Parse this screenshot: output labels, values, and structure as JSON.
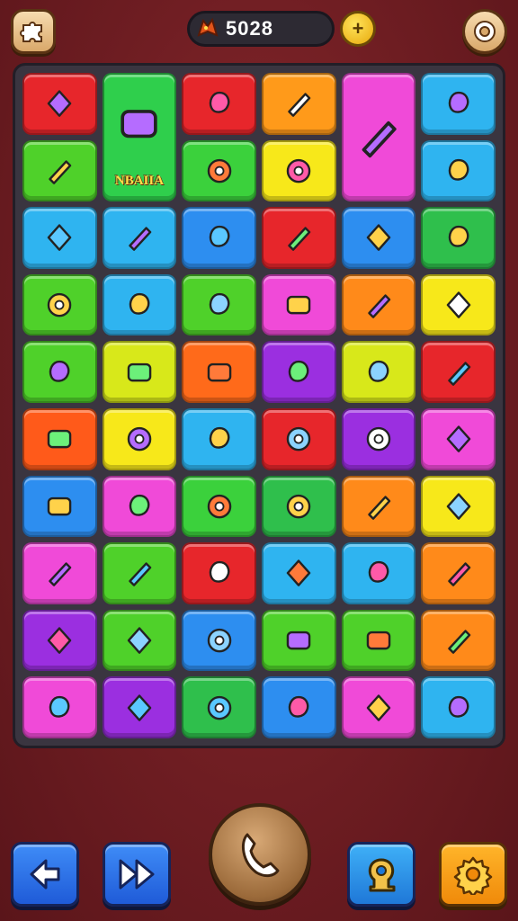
{
  "header": {
    "score": "5028",
    "coin_symbol": "+",
    "left_button_icon": "puzzle-icon",
    "right_button_icon": "settings-ring-icon",
    "score_icon": "dragon-head-icon"
  },
  "board": {
    "tiles": [
      {
        "color": "#e7262b",
        "icon": "toolbox-icon"
      },
      {
        "color": "#2fcf4c",
        "icon": "eagle-emblem-icon",
        "label": "NBAIIA"
      },
      {
        "color": "#e7262b",
        "icon": "flower-gear-icon"
      },
      {
        "color": "#ff9a1a",
        "icon": "ring-icon"
      },
      {
        "color": "#f04ad8",
        "icon": "dragon-icon"
      },
      {
        "color": "#2fb4f0",
        "icon": "flower-icon"
      },
      {
        "color": "#4fd12a",
        "icon": "battery-icon"
      },
      {
        "color": "#3bd13c",
        "icon": "car-icon"
      },
      {
        "color": "#f7e81a",
        "icon": "spiral-icon"
      },
      {
        "color": "#2fb4f0",
        "icon": "egg-icon"
      },
      {
        "color": "#2fb4f0",
        "icon": "gem-icon"
      },
      {
        "color": "#2fb4f0",
        "icon": "box-icon"
      },
      {
        "color": "#2d8ef0",
        "icon": "gear-icon"
      },
      {
        "color": "#e7262b",
        "icon": "briefcase-icon"
      },
      {
        "color": "#2d8ef0",
        "icon": "roast-icon"
      },
      {
        "color": "#2fbf4c",
        "icon": "stone-icon"
      },
      {
        "color": "#4fd12a",
        "icon": "pencil-icon"
      },
      {
        "color": "#2fb4f0",
        "icon": "blob-icon"
      },
      {
        "color": "#4fd12a",
        "icon": "crayon-icon"
      },
      {
        "color": "#f04ad8",
        "icon": "cactus-icon"
      },
      {
        "color": "#ff8a1a",
        "icon": "jar-icon"
      },
      {
        "color": "#f7e81a",
        "icon": "lips-icon"
      },
      {
        "color": "#4fd12a",
        "icon": "radio-icon"
      },
      {
        "color": "#d8e81a",
        "icon": "tv-icon"
      },
      {
        "color": "#ff6a1a",
        "icon": "cookie-icon"
      },
      {
        "color": "#9b2fe0",
        "icon": "bowl-icon"
      },
      {
        "color": "#d8e81a",
        "icon": "leaf-icon"
      },
      {
        "color": "#e7262b",
        "icon": "orb-icon"
      },
      {
        "color": "#ff5a1a",
        "icon": "marker-icon"
      },
      {
        "color": "#f7e81a",
        "icon": "drill-icon"
      },
      {
        "color": "#2fb4f0",
        "icon": "cloud-icon"
      },
      {
        "color": "#e7262b",
        "icon": "heart-icon"
      },
      {
        "color": "#9b2fe0",
        "icon": "wand-icon"
      },
      {
        "color": "#f04ad8",
        "icon": "hook-icon"
      },
      {
        "color": "#2d8ef0",
        "icon": "camera-icon"
      },
      {
        "color": "#f04ad8",
        "icon": "monitor-icon"
      },
      {
        "color": "#3bd13c",
        "icon": "sun-icon"
      },
      {
        "color": "#2fbf4c",
        "icon": "maple-icon"
      },
      {
        "color": "#ff8a1a",
        "icon": "crossed-tools-icon"
      },
      {
        "color": "#f7e81a",
        "icon": "dino-icon"
      },
      {
        "color": "#f04ad8",
        "icon": "cone-icon"
      },
      {
        "color": "#4fd12a",
        "icon": "rose-icon"
      },
      {
        "color": "#e7262b",
        "icon": "fish-icon"
      },
      {
        "color": "#2fb4f0",
        "icon": "purple-egg-icon"
      },
      {
        "color": "#2fb4f0",
        "icon": "target-icon"
      },
      {
        "color": "#ff8a1a",
        "icon": "snail-icon"
      },
      {
        "color": "#9b2fe0",
        "icon": "peanut-icon"
      },
      {
        "color": "#4fd12a",
        "icon": "molecule-icon"
      },
      {
        "color": "#2d8ef0",
        "icon": "clock-icon"
      },
      {
        "color": "#4fd12a",
        "icon": "feather-icon"
      },
      {
        "color": "#4fd12a",
        "icon": "bone-icon"
      },
      {
        "color": "#ff8a1a",
        "icon": "robot-icon"
      },
      {
        "color": "#f04ad8",
        "icon": "kite-icon"
      },
      {
        "color": "#9b2fe0",
        "icon": "machine-icon"
      },
      {
        "color": "#2fbf4c",
        "icon": "cheese-icon"
      },
      {
        "color": "#2d8ef0",
        "icon": "leaf-blade-icon"
      },
      {
        "color": "#f04ad8",
        "icon": "sign-icon"
      },
      {
        "color": "#2fb4f0",
        "icon": "crate-icon"
      }
    ]
  },
  "footer": {
    "back_icon": "arrow-left-icon",
    "forward_icon": "fast-forward-icon",
    "center_icon": "phone-icon",
    "hint_icon": "key-icon",
    "settings_icon": "gear-icon"
  }
}
